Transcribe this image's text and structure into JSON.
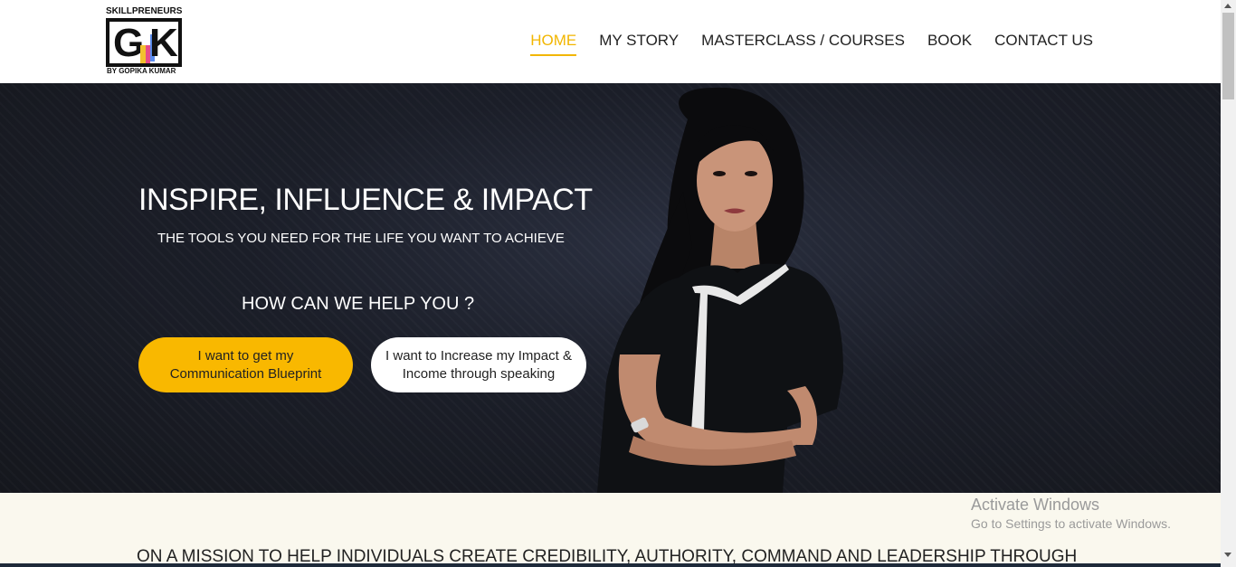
{
  "logo": {
    "top_text": "SKILLPRENEURS",
    "letters_g": "G",
    "letters_k": "K",
    "bottom_text": "BY GOPIKA KUMAR"
  },
  "nav": {
    "items": [
      "HOME",
      "MY STORY",
      "MASTERCLASS / COURSES",
      "BOOK",
      "CONTACT US"
    ],
    "active": "HOME"
  },
  "hero": {
    "title": "INSPIRE, INFLUENCE & IMPACT",
    "subtitle": "THE TOOLS YOU NEED FOR THE LIFE YOU WANT TO ACHIEVE",
    "help_heading": "HOW CAN WE HELP YOU ?",
    "button_blueprint": "I want to get my Communication Blueprint",
    "button_impact": "I want to Increase my Impact & Income through speaking"
  },
  "mission": {
    "text": "ON A MISSION TO HELP INDIVIDUALS CREATE CREDIBILITY, AUTHORITY, COMMAND AND LEADERSHIP THROUGH"
  },
  "watermark": {
    "title": "Activate Windows",
    "subtitle": "Go to Settings to activate Windows."
  },
  "colors": {
    "accent": "#f9b800",
    "hero_bg": "#1b1e28",
    "mission_bg": "#faf8ee"
  }
}
